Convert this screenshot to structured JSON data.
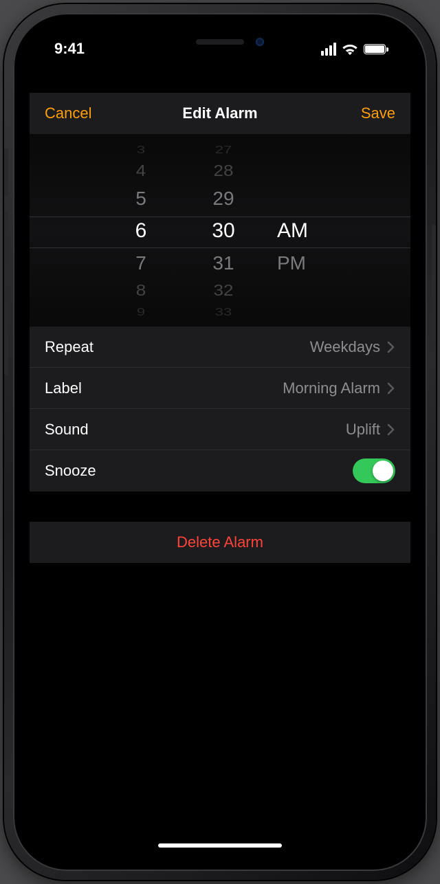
{
  "status": {
    "time": "9:41"
  },
  "nav": {
    "cancel": "Cancel",
    "title": "Edit Alarm",
    "save": "Save"
  },
  "picker": {
    "hour": {
      "sel": "6",
      "above1": "5",
      "above2": "4",
      "above3": "3",
      "below1": "7",
      "below2": "8",
      "below3": "9"
    },
    "minute": {
      "sel": "30",
      "above1": "29",
      "above2": "28",
      "above3": "27",
      "below1": "31",
      "below2": "32",
      "below3": "33"
    },
    "ampm": {
      "sel": "AM",
      "below1": "PM"
    }
  },
  "rows": {
    "repeat": {
      "label": "Repeat",
      "value": "Weekdays"
    },
    "label": {
      "label": "Label",
      "value": "Morning Alarm"
    },
    "sound": {
      "label": "Sound",
      "value": "Uplift"
    },
    "snooze": {
      "label": "Snooze",
      "on": true
    }
  },
  "delete": {
    "label": "Delete Alarm"
  }
}
